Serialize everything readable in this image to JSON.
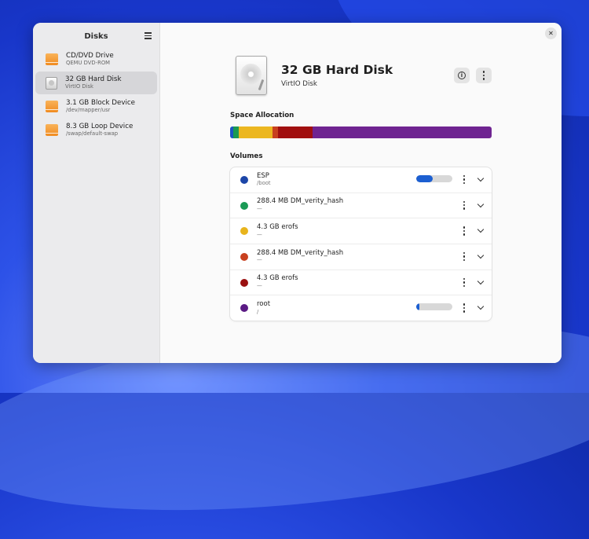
{
  "sidebar": {
    "title": "Disks",
    "items": [
      {
        "name": "CD/DVD Drive",
        "sub": "QEMU DVD-ROM",
        "icon": "optical-drive-icon",
        "active": false
      },
      {
        "name": "32 GB Hard Disk",
        "sub": "VirtIO Disk",
        "icon": "hard-disk-icon",
        "active": true
      },
      {
        "name": "3.1 GB Block Device",
        "sub": "/dev/mapper/usr",
        "icon": "block-device-icon",
        "active": false
      },
      {
        "name": "8.3 GB Loop Device",
        "sub": "/swap/default-swap",
        "icon": "loop-device-icon",
        "active": false
      }
    ]
  },
  "header": {
    "close_glyph": "✕",
    "title": "32 GB Hard Disk",
    "subtitle": "VirtIO Disk",
    "info_glyph": "i"
  },
  "space_allocation": {
    "title": "Space Allocation",
    "segments": [
      {
        "color": "#1c55c4",
        "fraction": 0.012
      },
      {
        "color": "#1b9a52",
        "fraction": 0.02
      },
      {
        "color": "#ecb720",
        "fraction": 0.131
      },
      {
        "color": "#c8401f",
        "fraction": 0.02
      },
      {
        "color": "#a10f0f",
        "fraction": 0.131
      },
      {
        "color": "#6f2491",
        "fraction": 0.686
      }
    ]
  },
  "volumes": {
    "title": "Volumes",
    "rows": [
      {
        "name": "ESP",
        "sub": "/boot",
        "color": "#1c46a8",
        "usage": 0.45
      },
      {
        "name": "288.4 MB DM_verity_hash",
        "sub": "—",
        "color": "#1a9a55",
        "usage": null
      },
      {
        "name": "4.3 GB erofs",
        "sub": "—",
        "color": "#e8b41c",
        "usage": null
      },
      {
        "name": "288.4 MB DM_verity_hash",
        "sub": "—",
        "color": "#c8401f",
        "usage": null
      },
      {
        "name": "4.3 GB erofs",
        "sub": "—",
        "color": "#9a1010",
        "usage": null
      },
      {
        "name": "root",
        "sub": "/",
        "color": "#5a1a84",
        "usage": 0.09
      }
    ]
  }
}
